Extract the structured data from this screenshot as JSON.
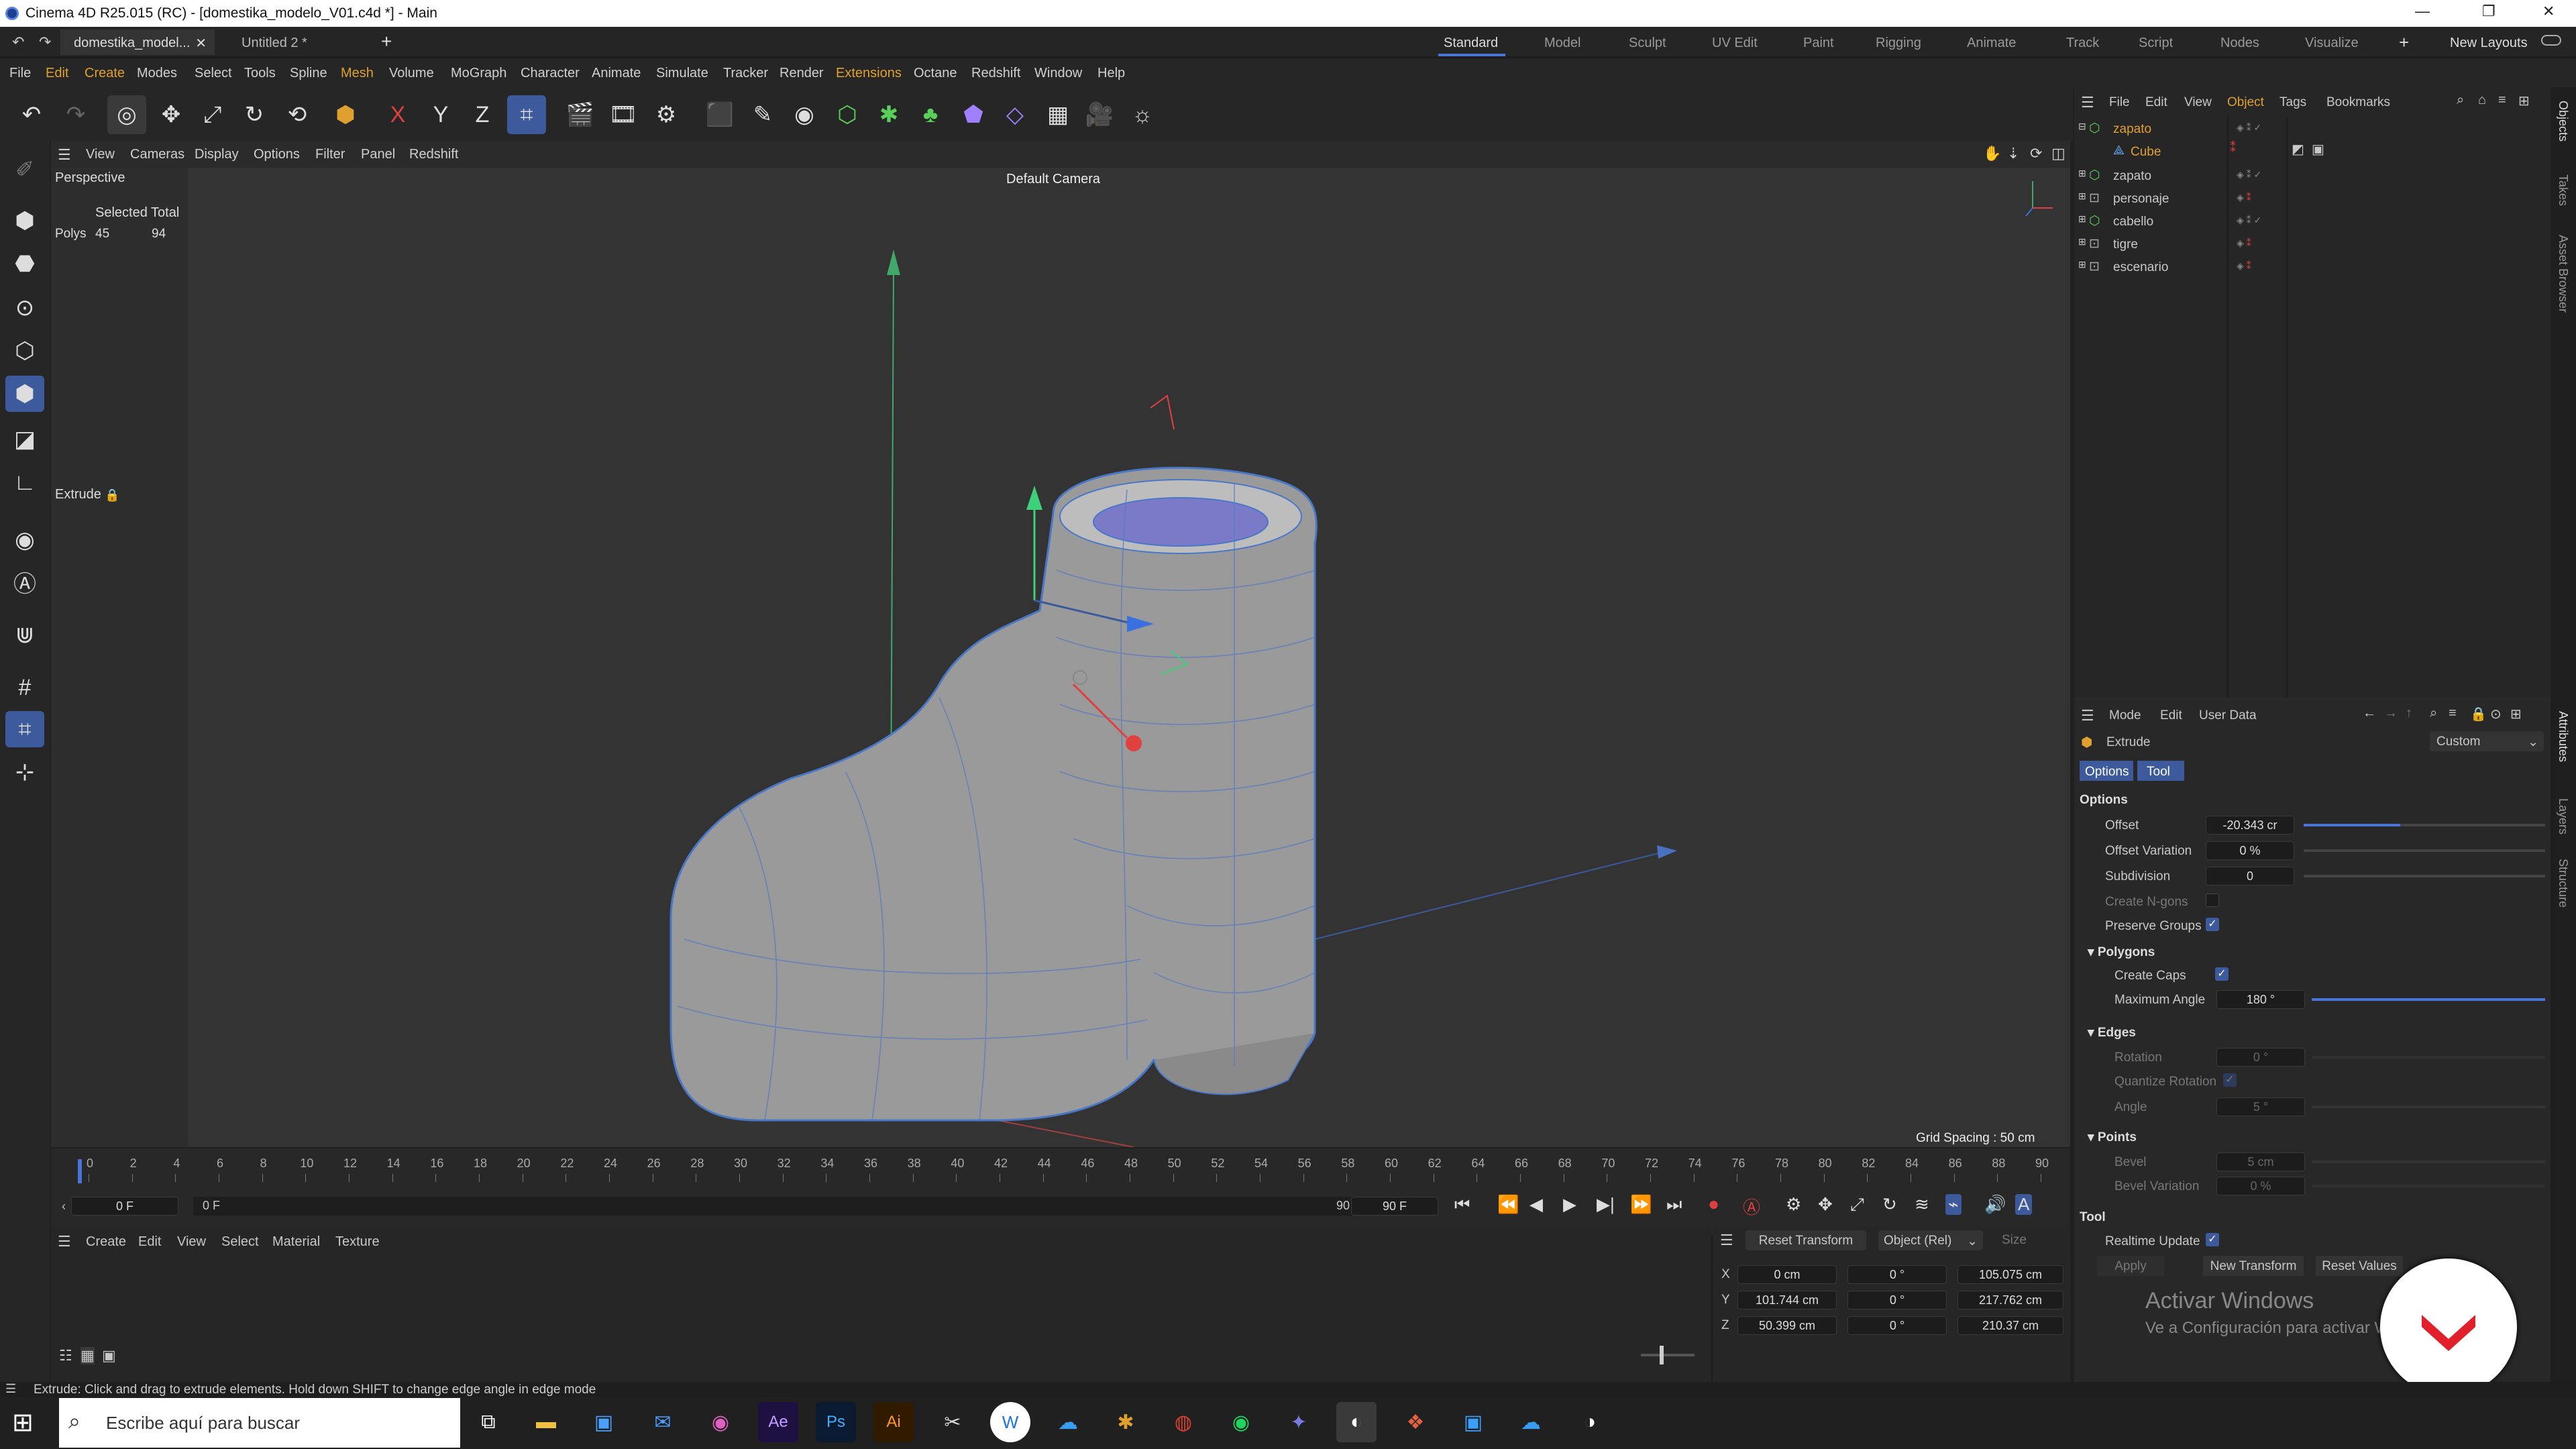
{
  "window": {
    "title": "Cinema 4D R25.015 (RC) - [domestika_modelo_V01.c4d *] - Main"
  },
  "tabs": [
    {
      "label": "domestika_model...",
      "active": true
    },
    {
      "label": "Untitled 2 *",
      "active": false
    }
  ],
  "layouts": [
    "Standard",
    "Model",
    "Sculpt",
    "UV Edit",
    "Paint",
    "Rigging",
    "Animate",
    "Track",
    "Script",
    "Nodes",
    "Visualize"
  ],
  "new_layouts": "New Layouts",
  "menus": [
    "File",
    "Edit",
    "Create",
    "Modes",
    "Select",
    "Tools",
    "Spline",
    "Mesh",
    "Volume",
    "MoGraph",
    "Character",
    "Animate",
    "Simulate",
    "Tracker",
    "Render",
    "Extensions",
    "Octane",
    "Redshift",
    "Window",
    "Help"
  ],
  "viewport": {
    "menus": [
      "View",
      "Cameras",
      "Display",
      "Options",
      "Filter",
      "Panel",
      "Redshift"
    ],
    "mode": "Perspective",
    "camera": "Default Camera",
    "grid_spacing": "Grid Spacing : 50 cm",
    "info_header": "Selected Total",
    "polys_label": "Polys",
    "polys_selected": "45",
    "polys_total": "94",
    "tool_label": "Extrude"
  },
  "timeline": {
    "ticks": [
      "0",
      "2",
      "4",
      "6",
      "8",
      "10",
      "12",
      "14",
      "16",
      "18",
      "20",
      "22",
      "24",
      "26",
      "28",
      "30",
      "32",
      "34",
      "36",
      "38",
      "40",
      "42",
      "44",
      "46",
      "48",
      "50",
      "52",
      "54",
      "56",
      "58",
      "60",
      "62",
      "64",
      "66",
      "68",
      "70",
      "72",
      "74",
      "76",
      "78",
      "80",
      "82",
      "84",
      "86",
      "88",
      "90"
    ],
    "current_frame": "0 F",
    "start_frame": "0 F",
    "end_frame": "90 F",
    "end_frame2": "90 F"
  },
  "materials_menu": [
    "Create",
    "Edit",
    "View",
    "Select",
    "Material",
    "Texture"
  ],
  "coords": {
    "reset_transform": "Reset Transform",
    "mode": "Object (Rel)",
    "size_label": "Size",
    "rows": [
      {
        "axis": "X",
        "pos": "0 cm",
        "rot": "0 °",
        "size": "105.075 cm"
      },
      {
        "axis": "Y",
        "pos": "101.744 cm",
        "rot": "0 °",
        "size": "217.762 cm"
      },
      {
        "axis": "Z",
        "pos": "50.399 cm",
        "rot": "0 °",
        "size": "210.37 cm"
      }
    ]
  },
  "object_manager": {
    "menus": [
      "File",
      "Edit",
      "View",
      "Object",
      "Tags",
      "Bookmarks"
    ],
    "objects": [
      {
        "name": "zapato",
        "color": "#e0a030",
        "level": 0
      },
      {
        "name": "Cube",
        "color": "#e0a030",
        "level": 1
      },
      {
        "name": "zapato",
        "color": "#c8c8c8",
        "level": 0
      },
      {
        "name": "personaje",
        "color": "#c8c8c8",
        "level": 0
      },
      {
        "name": "cabello",
        "color": "#c8c8c8",
        "level": 0
      },
      {
        "name": "tigre",
        "color": "#c8c8c8",
        "level": 0
      },
      {
        "name": "escenario",
        "color": "#c8c8c8",
        "level": 0
      }
    ]
  },
  "attributes": {
    "menus": [
      "Mode",
      "Edit",
      "User Data"
    ],
    "tool_name": "Extrude",
    "preset": "Custom",
    "tabs": [
      "Options",
      "Tool"
    ],
    "options_header": "Options",
    "offset_label": "Offset",
    "offset_value": "-20.343 cr",
    "offset_slider": 0.4,
    "offset_var_label": "Offset Variation",
    "offset_var_value": "0 %",
    "subdivision_label": "Subdivision",
    "subdivision_value": "0",
    "create_ngons_label": "Create N-gons",
    "preserve_groups_label": "Preserve Groups",
    "polygons_header": "Polygons",
    "create_caps_label": "Create Caps",
    "max_angle_label": "Maximum Angle",
    "max_angle_value": "180 °",
    "max_angle_slider": 1.0,
    "edges_header": "Edges",
    "rotation_label": "Rotation",
    "rotation_value": "0 °",
    "quantize_label": "Quantize Rotation",
    "angle_label": "Angle",
    "angle_value": "5 °",
    "points_header": "Points",
    "bevel_label": "Bevel",
    "bevel_value": "5 cm",
    "bevel_var_label": "Bevel Variation",
    "bevel_var_value": "0 %",
    "tool_header": "Tool",
    "realtime_label": "Realtime Update",
    "apply": "Apply",
    "new_transform": "New Transform",
    "reset_values": "Reset Values"
  },
  "side_tabs": [
    "Objects",
    "Takes",
    "Asset Browser",
    "Attributes",
    "Layers",
    "Structure"
  ],
  "watermark": {
    "title": "Activar Windows",
    "subtitle": "Ve a Configuración para activar Windows."
  },
  "status": "Extrude: Click and drag to extrude elements. Hold down SHIFT to change edge angle in edge mode",
  "taskbar": {
    "search_placeholder": "Escribe aquí para buscar"
  }
}
